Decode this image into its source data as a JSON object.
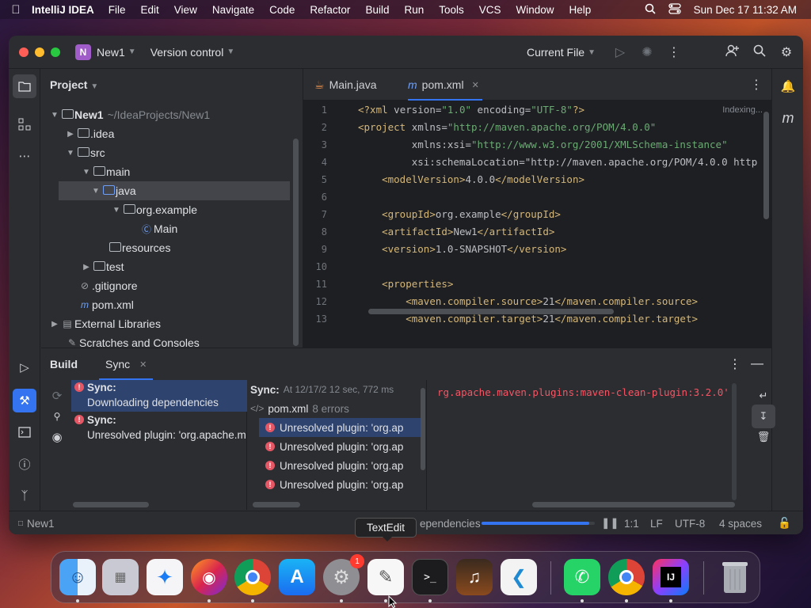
{
  "menubar": {
    "app_name": "IntelliJ IDEA",
    "items": [
      "File",
      "Edit",
      "View",
      "Navigate",
      "Code",
      "Refactor",
      "Build",
      "Run",
      "Tools",
      "VCS",
      "Window",
      "Help"
    ],
    "datetime": "Sun Dec 17  11:32 AM"
  },
  "titlebar": {
    "project_badge": "N",
    "project_name": "New1",
    "vcs": "Version control",
    "run_config": "Current File"
  },
  "project_panel": {
    "title": "Project",
    "rows": [
      {
        "label": "New1",
        "hint": "~/IdeaProjects/New1"
      },
      {
        "label": ".idea"
      },
      {
        "label": "src"
      },
      {
        "label": "main"
      },
      {
        "label": "java"
      },
      {
        "label": "org.example"
      },
      {
        "label": "Main"
      },
      {
        "label": "resources"
      },
      {
        "label": "test"
      },
      {
        "label": ".gitignore"
      },
      {
        "label": "pom.xml"
      },
      {
        "label": "External Libraries"
      },
      {
        "label": "Scratches and Consoles"
      }
    ]
  },
  "editor": {
    "tabs": [
      {
        "label": "Main.java"
      },
      {
        "label": "pom.xml",
        "active": true
      }
    ],
    "indexing": "Indexing...",
    "line_numbers": [
      "1",
      "2",
      "3",
      "4",
      "5",
      "6",
      "7",
      "8",
      "9",
      "10",
      "11",
      "12",
      "13"
    ],
    "lines": [
      "<?xml version=\"1.0\" encoding=\"UTF-8\"?>",
      "<project xmlns=\"http://maven.apache.org/POM/4.0.0\"",
      "         xmlns:xsi=\"http://www.w3.org/2001/XMLSchema-instance\"",
      "         xsi:schemaLocation=\"http://maven.apache.org/POM/4.0.0 http",
      "    <modelVersion>4.0.0</modelVersion>",
      "",
      "    <groupId>org.example</groupId>",
      "    <artifactId>New1</artifactId>",
      "    <version>1.0-SNAPSHOT</version>",
      "",
      "    <properties>",
      "        <maven.compiler.source>21</maven.compiler.source>",
      "        <maven.compiler.target>21</maven.compiler.target>"
    ]
  },
  "build_panel": {
    "tabs": [
      "Build",
      "Sync"
    ],
    "sync_items": [
      {
        "title": "Sync:",
        "detail": "Downloading dependencies"
      },
      {
        "title": "Sync:",
        "detail": "Unresolved plugin: 'org.apache.m"
      }
    ],
    "tree_header": {
      "title": "Sync:",
      "meta": "At 12/17/2 12 sec, 772 ms"
    },
    "tree_file": {
      "name": "pom.xml",
      "errors": "8 errors"
    },
    "tree_errors": [
      "Unresolved plugin: 'org.ap",
      "Unresolved plugin: 'org.ap",
      "Unresolved plugin: 'org.ap",
      "Unresolved plugin: 'org.ap"
    ],
    "console_text": "rg.apache.maven.plugins:maven-clean-plugin:3.2.0'"
  },
  "statusbar": {
    "project": "New1",
    "task": "ependencies",
    "progress": 0.95,
    "position": "1:1",
    "line_sep": "LF",
    "encoding": "UTF-8",
    "indent": "4 spaces"
  },
  "tooltip": "TextEdit",
  "dock": {
    "settings_badge": "1",
    "intellij_label": "IJ"
  }
}
